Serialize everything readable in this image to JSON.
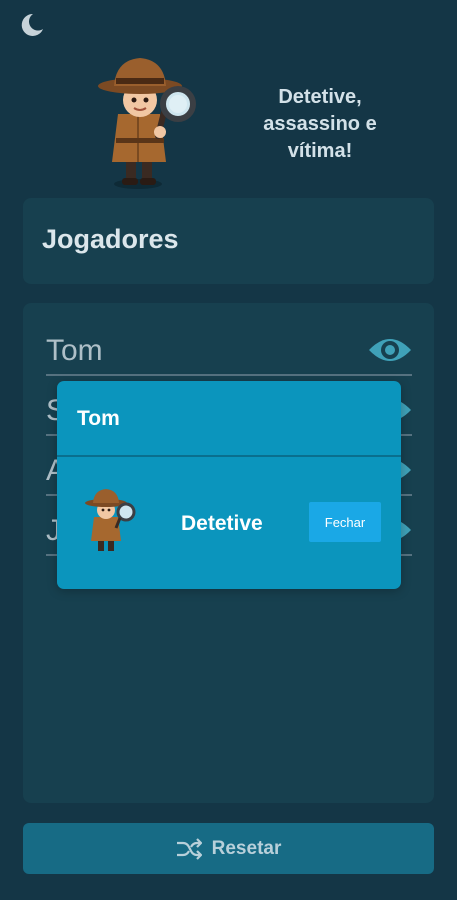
{
  "header": {
    "moon_icon": "moon-icon",
    "tagline": "Detetive,\nassassino e\nvítima!"
  },
  "players": {
    "title": "Jogadores",
    "items": [
      {
        "name": "Tom"
      },
      {
        "name": "S"
      },
      {
        "name": "A"
      },
      {
        "name": "J"
      }
    ]
  },
  "reset": {
    "label": "Resetar",
    "icon": "shuffle-icon"
  },
  "modal": {
    "player_name": "Tom",
    "role": "Detetive",
    "close_label": "Fechar"
  },
  "colors": {
    "background": "#143646",
    "card": "#17404f",
    "modal": "#0b95bd",
    "accent": "#1aa8e6",
    "eye": "#3fa1b8"
  }
}
